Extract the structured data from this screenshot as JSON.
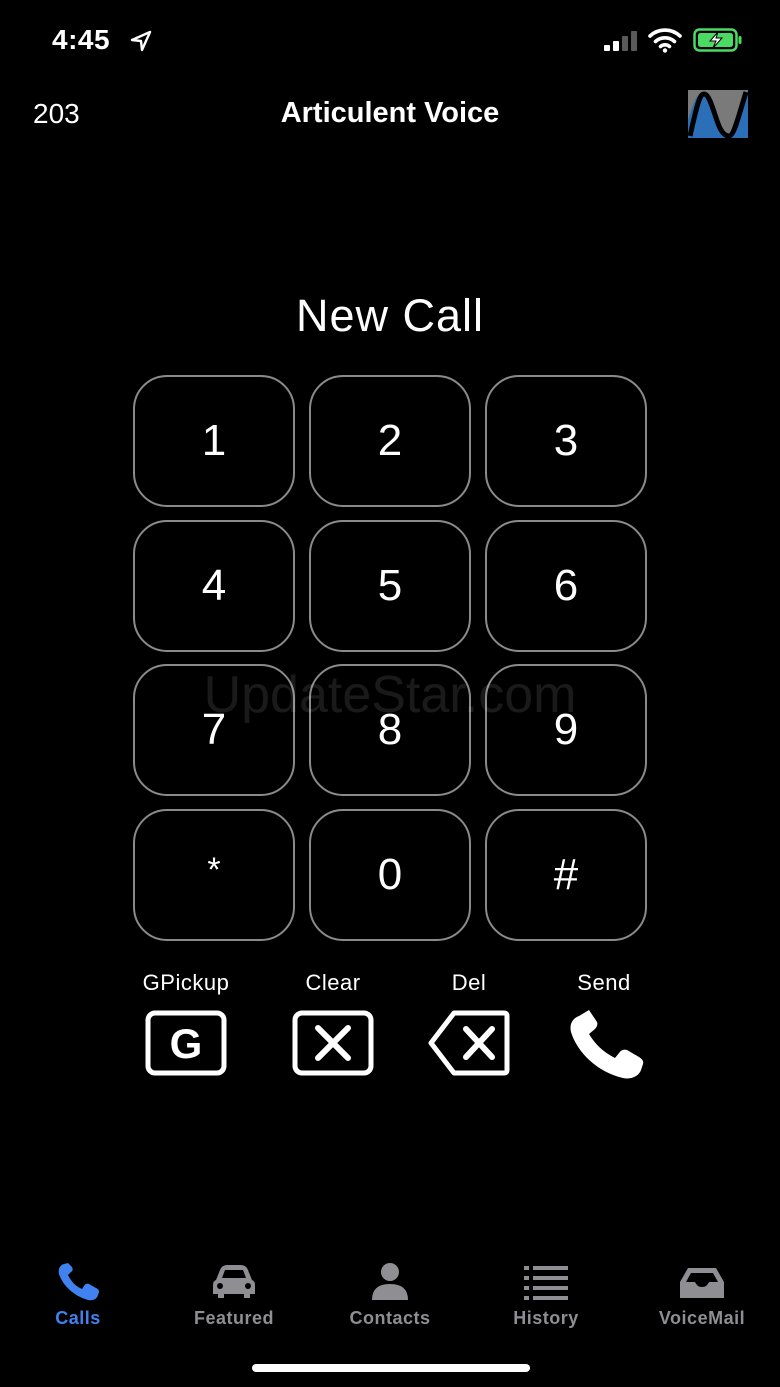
{
  "status_bar": {
    "time": "4:45",
    "icons": [
      "location-arrow-icon",
      "cellular-signal-icon",
      "wifi-icon",
      "battery-charging-icon"
    ],
    "battery_color": "#4cd964"
  },
  "header": {
    "extension": "203",
    "title": "Articulent Voice",
    "logo_icon": "articulent-logo-icon",
    "logo_color": "#2b6fb8"
  },
  "dialer": {
    "title": "New Call",
    "keys": [
      "1",
      "2",
      "3",
      "4",
      "5",
      "6",
      "7",
      "8",
      "9",
      "*",
      "0",
      "#"
    ]
  },
  "watermark": "UpdateStar.com",
  "actions": [
    {
      "label": "GPickup",
      "icon": "group-pickup-icon",
      "glyph": "G"
    },
    {
      "label": "Clear",
      "icon": "clear-icon"
    },
    {
      "label": "Del",
      "icon": "backspace-icon"
    },
    {
      "label": "Send",
      "icon": "phone-icon"
    }
  ],
  "tabs": [
    {
      "label": "Calls",
      "icon": "phone-icon",
      "active": true
    },
    {
      "label": "Featured",
      "icon": "car-icon",
      "active": false
    },
    {
      "label": "Contacts",
      "icon": "person-icon",
      "active": false
    },
    {
      "label": "History",
      "icon": "list-icon",
      "active": false
    },
    {
      "label": "VoiceMail",
      "icon": "inbox-tray-icon",
      "active": false
    }
  ],
  "colors": {
    "accent": "#3f82f0",
    "inactive": "#8e8e93",
    "key_border": "#8a8a8a"
  }
}
